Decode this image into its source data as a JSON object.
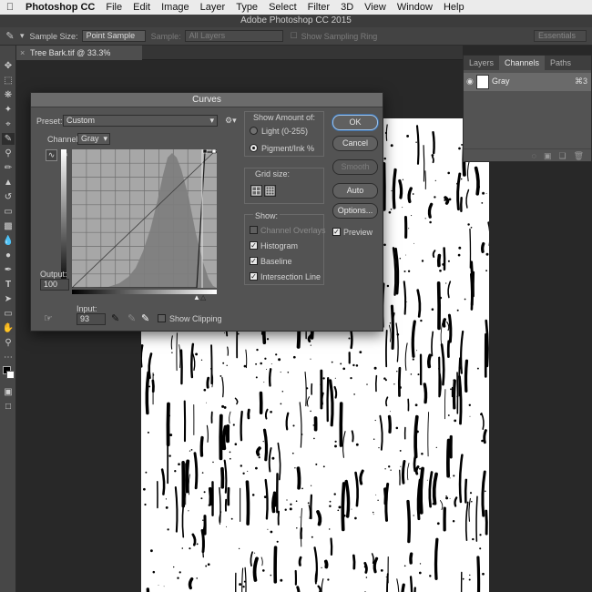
{
  "menubar": {
    "app": "Photoshop CC",
    "items": [
      "File",
      "Edit",
      "Image",
      "Layer",
      "Type",
      "Select",
      "Filter",
      "3D",
      "View",
      "Window",
      "Help"
    ]
  },
  "window": {
    "title": "Adobe Photoshop CC 2015"
  },
  "options_bar": {
    "sample_size_label": "Sample Size:",
    "sample_size_value": "Point Sample",
    "sample_label": "Sample:",
    "sample_value": "All Layers",
    "ring_label": "Show Sampling Ring",
    "workspace": "Essentials"
  },
  "document": {
    "tab_title": "Tree Bark.tif @ 33.3% (Gray/8) *",
    "close": "×"
  },
  "channels_panel": {
    "tabs": [
      "Layers",
      "Channels",
      "Paths"
    ],
    "active_tab": "Channels",
    "channel_name": "Gray",
    "channel_shortcut": "⌘3"
  },
  "curves": {
    "title": "Curves",
    "preset_label": "Preset:",
    "preset_value": "Custom",
    "channel_label": "Channel:",
    "channel_value": "Gray",
    "output_label": "Output:",
    "output_value": "100",
    "input_label": "Input:",
    "input_value": "93",
    "show_clipping": "Show Clipping",
    "show_amount_label": "Show Amount of:",
    "light_label": "Light  (0-255)",
    "pigment_label": "Pigment/Ink %",
    "grid_size_label": "Grid size:",
    "show_label": "Show:",
    "channel_overlays": "Channel Overlays",
    "histogram": "Histogram",
    "baseline": "Baseline",
    "intersection_line": "Intersection Line",
    "buttons": {
      "ok": "OK",
      "cancel": "Cancel",
      "smooth": "Smooth",
      "auto": "Auto",
      "options": "Options..."
    },
    "preview": "Preview",
    "preview_checked": true
  }
}
